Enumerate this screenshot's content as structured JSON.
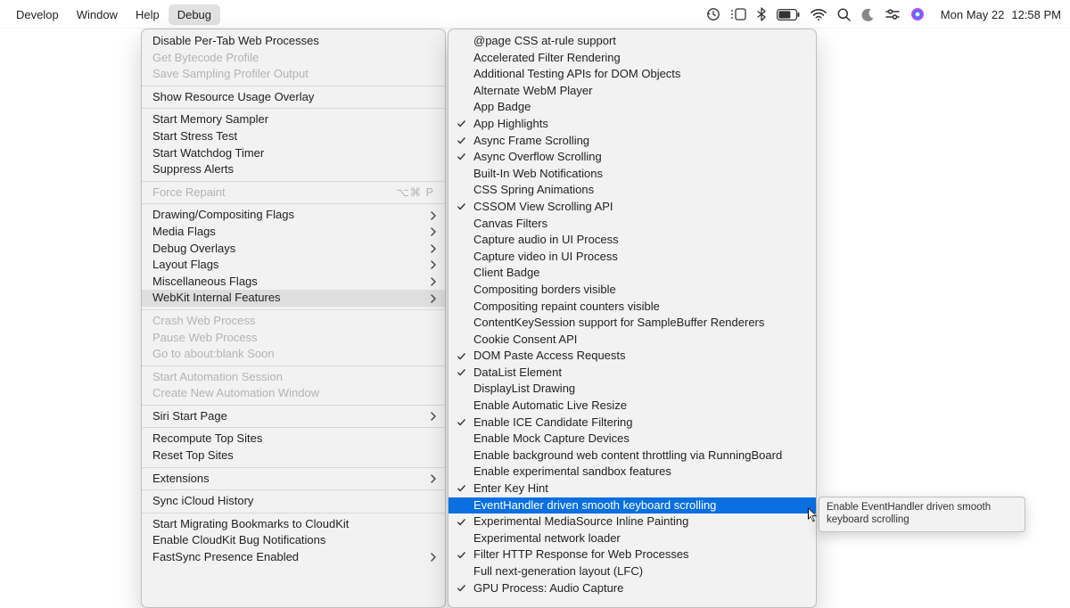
{
  "menubar": {
    "items": [
      {
        "label": "Develop",
        "active": false
      },
      {
        "label": "Window",
        "active": false
      },
      {
        "label": "Help",
        "active": false
      },
      {
        "label": "Debug",
        "active": true
      }
    ],
    "date": "Mon May 22",
    "time": "12:58 PM"
  },
  "debug_menu": [
    {
      "type": "item",
      "label": "Disable Per-Tab Web Processes"
    },
    {
      "type": "item",
      "label": "Get Bytecode Profile",
      "disabled": true
    },
    {
      "type": "item",
      "label": "Save Sampling Profiler Output",
      "disabled": true
    },
    {
      "type": "sep"
    },
    {
      "type": "item",
      "label": "Show Resource Usage Overlay"
    },
    {
      "type": "sep"
    },
    {
      "type": "item",
      "label": "Start Memory Sampler"
    },
    {
      "type": "item",
      "label": "Start Stress Test"
    },
    {
      "type": "item",
      "label": "Start Watchdog Timer"
    },
    {
      "type": "item",
      "label": "Suppress Alerts"
    },
    {
      "type": "sep"
    },
    {
      "type": "item",
      "label": "Force Repaint",
      "disabled": true,
      "shortcut": "⌥⌘ P"
    },
    {
      "type": "sep"
    },
    {
      "type": "item",
      "label": "Drawing/Compositing Flags",
      "submenu": true
    },
    {
      "type": "item",
      "label": "Media Flags",
      "submenu": true
    },
    {
      "type": "item",
      "label": "Debug Overlays",
      "submenu": true
    },
    {
      "type": "item",
      "label": "Layout Flags",
      "submenu": true
    },
    {
      "type": "item",
      "label": "Miscellaneous Flags",
      "submenu": true
    },
    {
      "type": "item",
      "label": "WebKit Internal Features",
      "submenu": true,
      "highlight": true
    },
    {
      "type": "sep"
    },
    {
      "type": "item",
      "label": "Crash Web Process",
      "disabled": true
    },
    {
      "type": "item",
      "label": "Pause Web Process",
      "disabled": true
    },
    {
      "type": "item",
      "label": "Go to about:blank Soon",
      "disabled": true
    },
    {
      "type": "sep"
    },
    {
      "type": "item",
      "label": "Start Automation Session",
      "disabled": true
    },
    {
      "type": "item",
      "label": "Create New Automation Window",
      "disabled": true
    },
    {
      "type": "sep"
    },
    {
      "type": "item",
      "label": "Siri Start Page",
      "submenu": true
    },
    {
      "type": "sep"
    },
    {
      "type": "item",
      "label": "Recompute Top Sites"
    },
    {
      "type": "item",
      "label": "Reset Top Sites"
    },
    {
      "type": "sep"
    },
    {
      "type": "item",
      "label": "Extensions",
      "submenu": true
    },
    {
      "type": "sep"
    },
    {
      "type": "item",
      "label": "Sync iCloud History"
    },
    {
      "type": "sep"
    },
    {
      "type": "item",
      "label": "Start Migrating Bookmarks to CloudKit"
    },
    {
      "type": "item",
      "label": "Enable CloudKit Bug Notifications"
    },
    {
      "type": "item",
      "label": "FastSync Presence Enabled",
      "submenu": true
    }
  ],
  "webkit_features": [
    {
      "label": "@page CSS at-rule support"
    },
    {
      "label": "Accelerated Filter Rendering"
    },
    {
      "label": "Additional Testing APIs for DOM Objects"
    },
    {
      "label": "Alternate WebM Player"
    },
    {
      "label": "App Badge"
    },
    {
      "label": "App Highlights",
      "checked": true
    },
    {
      "label": "Async Frame Scrolling",
      "checked": true
    },
    {
      "label": "Async Overflow Scrolling",
      "checked": true
    },
    {
      "label": "Built-In Web Notifications"
    },
    {
      "label": "CSS Spring Animations"
    },
    {
      "label": "CSSOM View Scrolling API",
      "checked": true
    },
    {
      "label": "Canvas Filters"
    },
    {
      "label": "Capture audio in UI Process"
    },
    {
      "label": "Capture video in UI Process"
    },
    {
      "label": "Client Badge"
    },
    {
      "label": "Compositing borders visible"
    },
    {
      "label": "Compositing repaint counters visible"
    },
    {
      "label": "ContentKeySession support for SampleBuffer Renderers"
    },
    {
      "label": "Cookie Consent API"
    },
    {
      "label": "DOM Paste Access Requests",
      "checked": true
    },
    {
      "label": "DataList Element",
      "checked": true
    },
    {
      "label": "DisplayList Drawing"
    },
    {
      "label": "Enable Automatic Live Resize"
    },
    {
      "label": "Enable ICE Candidate Filtering",
      "checked": true
    },
    {
      "label": "Enable Mock Capture Devices"
    },
    {
      "label": "Enable background web content throttling via RunningBoard"
    },
    {
      "label": "Enable experimental sandbox features"
    },
    {
      "label": "Enter Key Hint",
      "checked": true
    },
    {
      "label": "EventHandler driven smooth keyboard scrolling",
      "selected": true
    },
    {
      "label": "Experimental MediaSource Inline Painting",
      "checked": true
    },
    {
      "label": "Experimental network loader"
    },
    {
      "label": "Filter HTTP Response for Web Processes",
      "checked": true
    },
    {
      "label": "Full next-generation layout (LFC)"
    },
    {
      "label": "GPU Process: Audio Capture",
      "checked": true
    }
  ],
  "tooltip": "Enable EventHandler driven smooth keyboard scrolling"
}
